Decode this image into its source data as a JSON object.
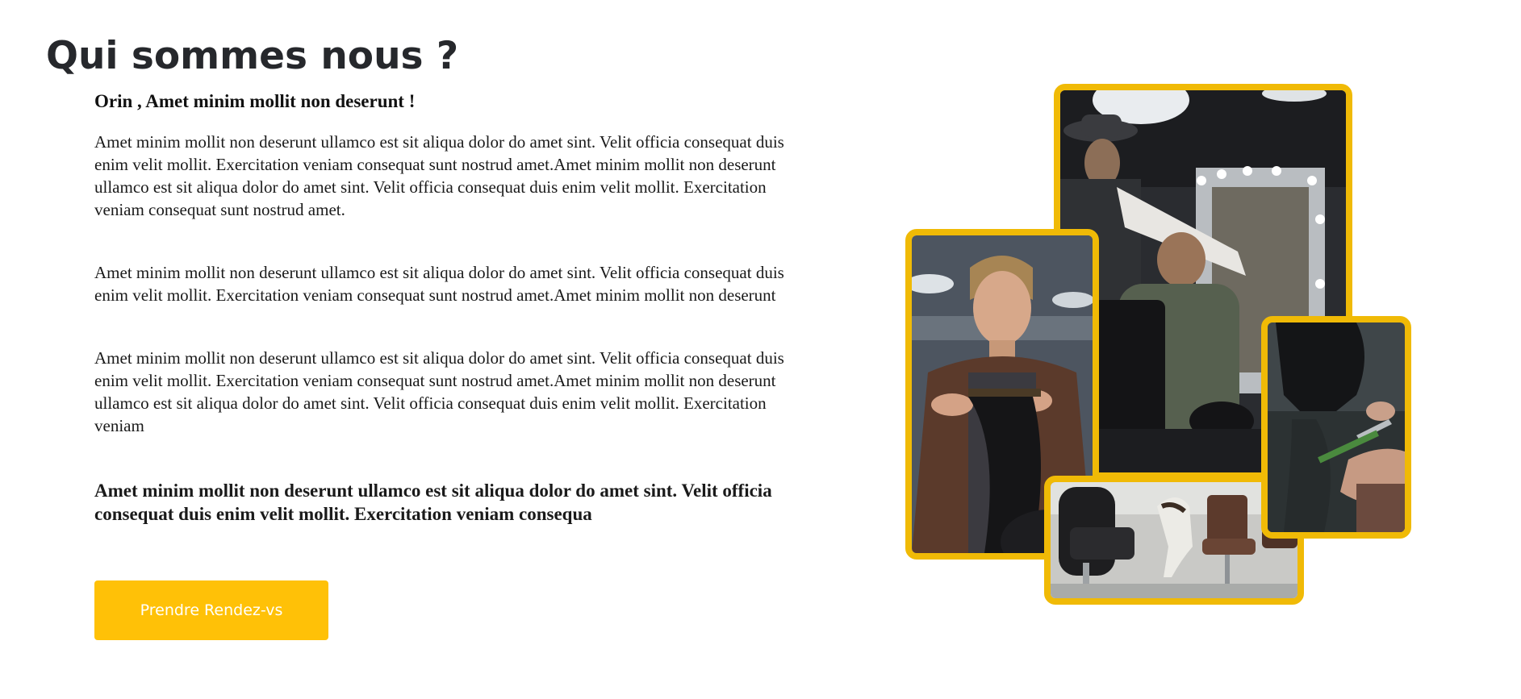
{
  "section": {
    "title": "Qui sommes nous ?",
    "subtitle": "Orin , Amet minim mollit non deserunt !",
    "paragraphs": [
      "Amet minim mollit non deserunt ullamco est sit aliqua dolor do amet sint. Velit officia consequat duis enim velit mollit. Exercitation veniam consequat sunt nostrud amet.Amet minim mollit non deserunt ullamco est sit aliqua dolor do amet sint. Velit officia consequat duis enim velit mollit. Exercitation veniam consequat sunt nostrud amet.",
      "Amet minim mollit non deserunt ullamco est sit aliqua dolor do amet sint. Velit officia consequat duis enim velit mollit. Exercitation veniam consequat sunt nostrud amet.Amet minim mollit non deserunt",
      "Amet minim mollit non deserunt ullamco est sit aliqua dolor do amet sint. Velit officia consequat duis enim velit mollit. Exercitation veniam consequat sunt nostrud amet.Amet minim mollit non deserunt ullamco est sit aliqua dolor do amet sint. Velit officia consequat duis enim velit mollit. Exercitation veniam"
    ],
    "highlight": "Amet minim mollit non deserunt ullamco est sit aliqua dolor do amet sint. Velit officia consequat duis enim velit mollit. Exercitation veniam consequa",
    "cta_label": "Prendre Rendez-vs"
  },
  "colors": {
    "accent": "#ffc107",
    "frame": "#f0ba06",
    "title": "#26282c"
  },
  "gallery": {
    "images": [
      "barber-cutting-hair-photo",
      "hairstylist-combing-hair-photo",
      "salon-chairs-photo",
      "scissors-haircut-photo"
    ]
  }
}
